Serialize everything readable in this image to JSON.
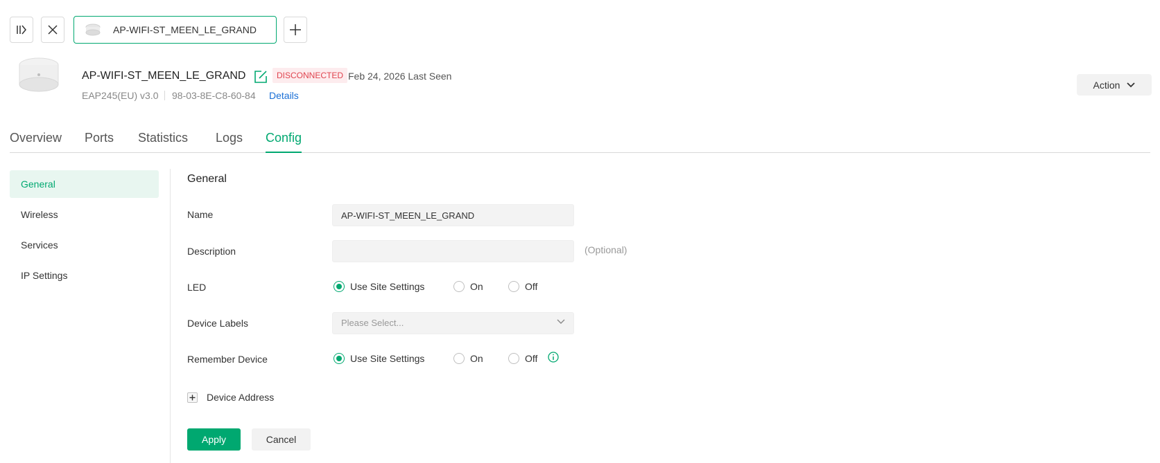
{
  "colors": {
    "accent": "#00a870",
    "danger": "#e0444f",
    "link": "#1a6fd6"
  },
  "toolbar": {
    "icons": [
      "sidebar-toggle-icon",
      "close-icon",
      "plus-icon"
    ],
    "open_tab_label": "AP-WIFI-ST_MEEN_LE_GRAND"
  },
  "device": {
    "name": "AP-WIFI-ST_MEEN_LE_GRAND",
    "status": "DISCONNECTED",
    "last_seen": "Feb 24, 2026 Last Seen",
    "model": "EAP245(EU) v3.0",
    "mac": "98-03-8E-C8-60-84",
    "details_link": "Details",
    "action_label": "Action"
  },
  "tabs": [
    {
      "label": "Overview"
    },
    {
      "label": "Ports"
    },
    {
      "label": "Statistics"
    },
    {
      "label": "Logs"
    },
    {
      "label": "Config",
      "active": true
    }
  ],
  "sidebar": {
    "items": [
      {
        "label": "General",
        "active": true
      },
      {
        "label": "Wireless"
      },
      {
        "label": "Services"
      },
      {
        "label": "IP Settings"
      }
    ]
  },
  "form": {
    "section_title": "General",
    "name": {
      "label": "Name",
      "value": "AP-WIFI-ST_MEEN_LE_GRAND"
    },
    "description": {
      "label": "Description",
      "value": "",
      "hint": "(Optional)"
    },
    "led": {
      "label": "LED",
      "options": [
        "Use Site Settings",
        "On",
        "Off"
      ],
      "selected": "Use Site Settings"
    },
    "device_labels": {
      "label": "Device Labels",
      "placeholder": "Please Select..."
    },
    "remember_device": {
      "label": "Remember Device",
      "options": [
        "Use Site Settings",
        "On",
        "Off"
      ],
      "selected": "Use Site Settings"
    },
    "device_address": {
      "label": "Device Address"
    },
    "apply_label": "Apply",
    "cancel_label": "Cancel"
  }
}
